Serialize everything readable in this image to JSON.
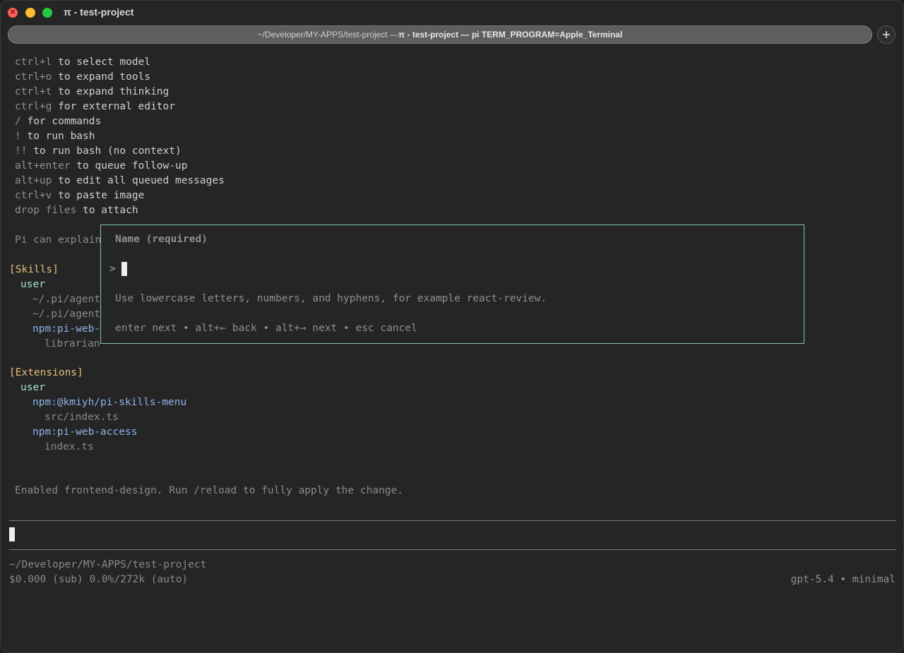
{
  "window": {
    "title": "π - test-project",
    "tab_path": "~/Developer/MY-APPS/test-project —",
    "tab_title": " π - test-project — pi TERM_PROGRAM=Apple_Terminal"
  },
  "help": [
    {
      "key": "ctrl+l",
      "desc": " to select model"
    },
    {
      "key": "ctrl+o",
      "desc": " to expand tools"
    },
    {
      "key": "ctrl+t",
      "desc": " to expand thinking"
    },
    {
      "key": "ctrl+g",
      "desc": " for external editor"
    },
    {
      "key": "/",
      "desc": " for commands"
    },
    {
      "key": "!",
      "desc": " to run bash"
    },
    {
      "key": "!!",
      "desc": " to run bash (no context)"
    },
    {
      "key": "alt+enter",
      "desc": " to queue follow-up"
    },
    {
      "key": "alt+up",
      "desc": " to edit all queued messages"
    },
    {
      "key": "ctrl+v",
      "desc": " to paste image"
    },
    {
      "key": "drop files",
      "desc": " to attach"
    }
  ],
  "intro_text": "Pi can explain",
  "skills": {
    "header": "[Skills]",
    "scope": "user",
    "items": [
      "~/.pi/agent",
      "~/.pi/agent",
      "npm:pi-web-",
      "librarian"
    ]
  },
  "extensions": {
    "header": "[Extensions]",
    "scope": "user",
    "packages": [
      {
        "name": "npm:@kmiyh/pi-skills-menu",
        "file": "src/index.ts"
      },
      {
        "name": "npm:pi-web-access",
        "file": "index.ts"
      }
    ]
  },
  "status_message": "Enabled frontend-design. Run /reload to fully apply the change.",
  "dialog": {
    "title": "Name (required)",
    "prompt": ">",
    "hint": "Use lowercase letters, numbers, and hyphens, for example react-review.",
    "shortcuts": "enter next • alt+← back • alt+→ next • esc cancel"
  },
  "footer": {
    "cwd": "~/Developer/MY-APPS/test-project",
    "usage": "$0.000 (sub) 0.0%/272k (auto)",
    "model": "gpt-5.4 • minimal"
  }
}
